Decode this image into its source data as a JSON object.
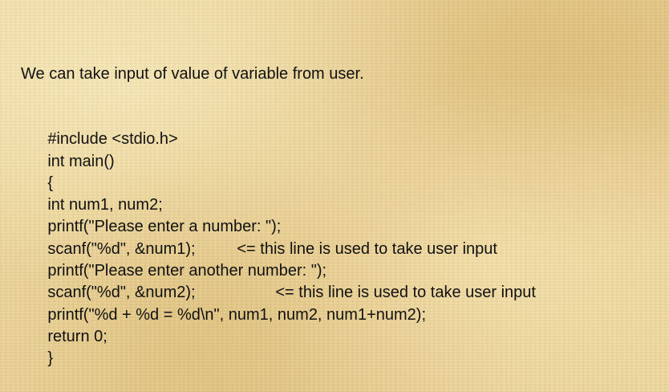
{
  "intro_text": "We can take input of value of variable from user.",
  "code_lines": [
    {
      "code": "#include <stdio.h>"
    },
    {
      "code": "int main()"
    },
    {
      "code": "{"
    },
    {
      "code": "int num1, num2;"
    },
    {
      "code": "printf(\"Please enter a number: \");"
    },
    {
      "code": "scanf(\"%d\", &num1);",
      "note": "<= this line is used to take user input"
    },
    {
      "code": "printf(\"Please enter another number: \");"
    },
    {
      "code": "scanf(\"%d\", &num2);",
      "note": "<= this line is used to take user input"
    },
    {
      "code": "printf(\"%d + %d = %d\\n\", num1, num2, num1+num2);"
    },
    {
      "code": "return 0;"
    },
    {
      "code": "}"
    }
  ]
}
